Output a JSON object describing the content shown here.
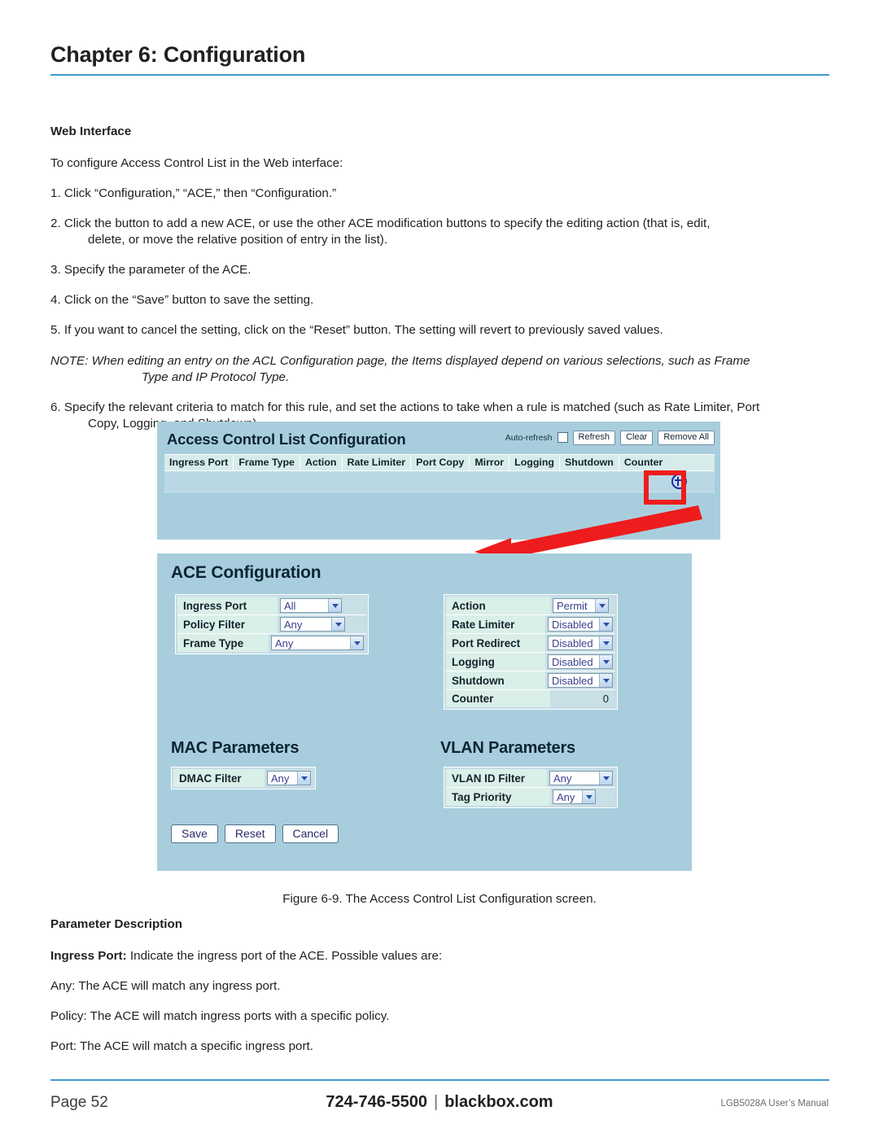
{
  "header": {
    "chapter_title": "Chapter 6: Configuration"
  },
  "body": {
    "section_heading": "Web Interface",
    "intro": "To configure Access Control List in the Web interface:",
    "steps": [
      "1. Click “Configuration,” “ACE,” then “Configuration.”",
      "2. Click the button to add a new ACE, or use the other ACE modification buttons to specify the editing action (that is, edit,",
      "delete, or move the relative position of entry in the list).",
      "3. Specify the parameter of the ACE.",
      "4. Click on the “Save” button to save the setting.",
      "5. If you want to cancel the setting, click on the “Reset” button. The setting will revert to previously saved values."
    ],
    "note_line1": "NOTE: When editing an entry on the ACL Configuration page, the Items displayed depend on various selections, such as Frame",
    "note_line2": "Type and IP Protocol Type.",
    "step6_line1": "6. Specify the relevant criteria to match for this rule, and set the actions to take when a rule is matched (such as Rate Limiter, Port",
    "step6_line2": "Copy, Logging, and Shutdown)."
  },
  "figure": {
    "caption": "Figure 6-9. The Access Control List Configuration screen.",
    "acl": {
      "title": "Access Control List Configuration",
      "auto_refresh_label": "Auto-refresh",
      "buttons": [
        "Refresh",
        "Clear",
        "Remove All"
      ],
      "columns": [
        "Ingress Port",
        "Frame Type",
        "Action",
        "Rate Limiter",
        "Port Copy",
        "Mirror",
        "Logging",
        "Shutdown",
        "Counter"
      ],
      "add_icon": "plus-circle-icon"
    },
    "ace": {
      "title": "ACE Configuration",
      "left_fields": [
        {
          "label": "Ingress Port",
          "value": "All"
        },
        {
          "label": "Policy Filter",
          "value": "Any"
        },
        {
          "label": "Frame Type",
          "value": "Any"
        }
      ],
      "right_fields": [
        {
          "label": "Action",
          "value": "Permit"
        },
        {
          "label": "Rate Limiter",
          "value": "Disabled"
        },
        {
          "label": "Port Redirect",
          "value": "Disabled"
        },
        {
          "label": "Logging",
          "value": "Disabled"
        },
        {
          "label": "Shutdown",
          "value": "Disabled"
        }
      ],
      "counter_label": "Counter",
      "counter_value": "0",
      "mac_title": "MAC Parameters",
      "mac_fields": [
        {
          "label": "DMAC Filter",
          "value": "Any"
        }
      ],
      "vlan_title": "VLAN Parameters",
      "vlan_fields": [
        {
          "label": "VLAN ID Filter",
          "value": "Any"
        },
        {
          "label": "Tag Priority",
          "value": "Any"
        }
      ],
      "buttons": [
        "Save",
        "Reset",
        "Cancel"
      ]
    },
    "annotation": {
      "highlight_color": "#ee1c1c",
      "shape": "red-callout-arrow"
    }
  },
  "lower": {
    "param_heading": "Parameter Description",
    "ingress_port_bold": "Ingress Port:",
    "ingress_port_rest": " Indicate the ingress port of the ACE. Possible values are:",
    "values": [
      "Any: The ACE will match any ingress port.",
      "Policy: The ACE will match ingress ports with a specific policy.",
      "Port: The ACE will match a specific ingress port."
    ]
  },
  "footer": {
    "page": "Page 52",
    "phone": "724-746-5500",
    "separator": "|",
    "site": "blackbox.com",
    "manual": "LGB5028A User’s Manual"
  }
}
